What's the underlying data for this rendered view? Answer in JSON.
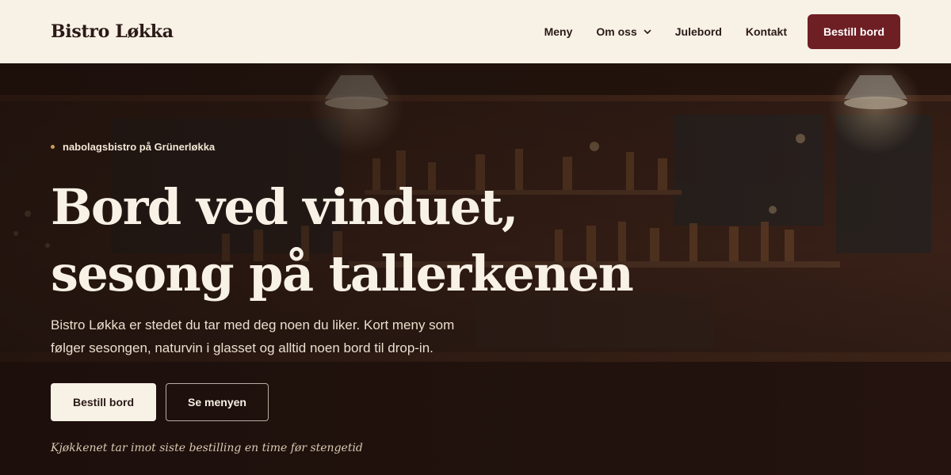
{
  "brand": "Bistro Løkka",
  "nav": {
    "items": [
      {
        "label": "Meny"
      },
      {
        "label": "Om oss"
      },
      {
        "label": "Julebord"
      },
      {
        "label": "Kontakt"
      }
    ],
    "cta_label": "Bestill bord"
  },
  "hero": {
    "eyebrow": "nabolagsbistro på Grünerløkka",
    "headline_line1": "Bord ved vinduet,",
    "headline_line2": "sesong på tallerkenen",
    "lede_line1": "Bistro Løkka er stedet du tar med deg noen du liker. Kort meny som",
    "lede_line2": "følger sesongen, naturvin i glasset og alltid noen bord til drop-in.",
    "primary_label": "Bestill bord",
    "secondary_label": "Se menyen",
    "note": "Kjøkkenet tar imot siste bestilling en time før stengetid"
  },
  "colors": {
    "header_bg": "#f8f1e6",
    "brand_text": "#2b1a17",
    "accent": "#6e1f24",
    "hero_text": "#f8f1e6"
  },
  "icons": {
    "dropdown": "chevron-down-icon",
    "eyebrow_dot": "dot-icon"
  }
}
